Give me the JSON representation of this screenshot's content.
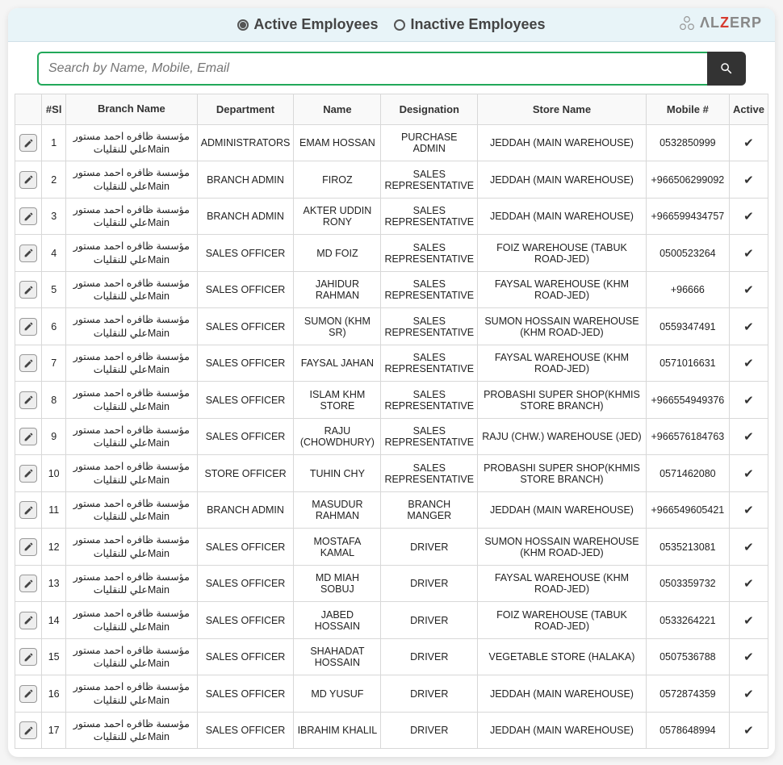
{
  "header": {
    "active_label": "Active Employees",
    "inactive_label": "Inactive Employees",
    "logo_text_1": "ΛL",
    "logo_text_2": "Z",
    "logo_text_3": "ERP"
  },
  "search": {
    "placeholder": "Search by Name, Mobile, Email"
  },
  "columns": {
    "si": "#Sl",
    "branch": "Branch Name",
    "dept": "Department",
    "name": "Name",
    "desig": "Designation",
    "store": "Store Name",
    "mobile": "Mobile #",
    "active": "Active"
  },
  "common": {
    "branch": "مؤسسة ظافره احمد مستور علي للنقلياتMain"
  },
  "rows": [
    {
      "si": "1",
      "dept": "ADMINISTRATORS",
      "name": "EMAM HOSSAN",
      "desig": "PURCHASE ADMIN",
      "store": "JEDDAH (MAIN WAREHOUSE)",
      "mobile": "0532850999"
    },
    {
      "si": "2",
      "dept": "BRANCH ADMIN",
      "name": "FIROZ",
      "desig": "SALES REPRESENTATIVE",
      "store": "JEDDAH (MAIN WAREHOUSE)",
      "mobile": "+966506299092"
    },
    {
      "si": "3",
      "dept": "BRANCH ADMIN",
      "name": "AKTER UDDIN RONY",
      "desig": "SALES REPRESENTATIVE",
      "store": "JEDDAH (MAIN WAREHOUSE)",
      "mobile": "+966599434757"
    },
    {
      "si": "4",
      "dept": "SALES OFFICER",
      "name": "MD FOIZ",
      "desig": "SALES REPRESENTATIVE",
      "store": "FOIZ WAREHOUSE (TABUK ROAD-JED)",
      "mobile": "0500523264"
    },
    {
      "si": "5",
      "dept": "SALES OFFICER",
      "name": "JAHIDUR RAHMAN",
      "desig": "SALES REPRESENTATIVE",
      "store": "FAYSAL WAREHOUSE (KHM ROAD-JED)",
      "mobile": "+96666"
    },
    {
      "si": "6",
      "dept": "SALES OFFICER",
      "name": "SUMON (KHM SR)",
      "desig": "SALES REPRESENTATIVE",
      "store": "SUMON HOSSAIN WAREHOUSE (KHM ROAD-JED)",
      "mobile": "0559347491"
    },
    {
      "si": "7",
      "dept": "SALES OFFICER",
      "name": "FAYSAL JAHAN",
      "desig": "SALES REPRESENTATIVE",
      "store": "FAYSAL WAREHOUSE (KHM ROAD-JED)",
      "mobile": "0571016631"
    },
    {
      "si": "8",
      "dept": "SALES OFFICER",
      "name": "ISLAM KHM STORE",
      "desig": "SALES REPRESENTATIVE",
      "store": "PROBASHI SUPER SHOP(KHMIS STORE BRANCH)",
      "mobile": "+966554949376"
    },
    {
      "si": "9",
      "dept": "SALES OFFICER",
      "name": "RAJU (CHOWDHURY)",
      "desig": "SALES REPRESENTATIVE",
      "store": "RAJU (CHW.) WAREHOUSE (JED)",
      "mobile": "+966576184763"
    },
    {
      "si": "10",
      "dept": "STORE OFFICER",
      "name": "TUHIN CHY",
      "desig": "SALES REPRESENTATIVE",
      "store": "PROBASHI SUPER SHOP(KHMIS STORE BRANCH)",
      "mobile": "0571462080"
    },
    {
      "si": "11",
      "dept": "BRANCH ADMIN",
      "name": "MASUDUR RAHMAN",
      "desig": "BRANCH MANGER",
      "store": "JEDDAH (MAIN WAREHOUSE)",
      "mobile": "+966549605421"
    },
    {
      "si": "12",
      "dept": "SALES OFFICER",
      "name": "MOSTAFA KAMAL",
      "desig": "DRIVER",
      "store": "SUMON HOSSAIN WAREHOUSE (KHM ROAD-JED)",
      "mobile": "0535213081"
    },
    {
      "si": "13",
      "dept": "SALES OFFICER",
      "name": "MD MIAH SOBUJ",
      "desig": "DRIVER",
      "store": "FAYSAL WAREHOUSE (KHM ROAD-JED)",
      "mobile": "0503359732"
    },
    {
      "si": "14",
      "dept": "SALES OFFICER",
      "name": "JABED HOSSAIN",
      "desig": "DRIVER",
      "store": "FOIZ WAREHOUSE (TABUK ROAD-JED)",
      "mobile": "0533264221"
    },
    {
      "si": "15",
      "dept": "SALES OFFICER",
      "name": "SHAHADAT HOSSAIN",
      "desig": "DRIVER",
      "store": "VEGETABLE STORE (HALAKA)",
      "mobile": "0507536788"
    },
    {
      "si": "16",
      "dept": "SALES OFFICER",
      "name": "MD YUSUF",
      "desig": "DRIVER",
      "store": "JEDDAH (MAIN WAREHOUSE)",
      "mobile": "0572874359"
    },
    {
      "si": "17",
      "dept": "SALES OFFICER",
      "name": "IBRAHIM KHALIL",
      "desig": "DRIVER",
      "store": "JEDDAH (MAIN WAREHOUSE)",
      "mobile": "0578648994"
    }
  ]
}
